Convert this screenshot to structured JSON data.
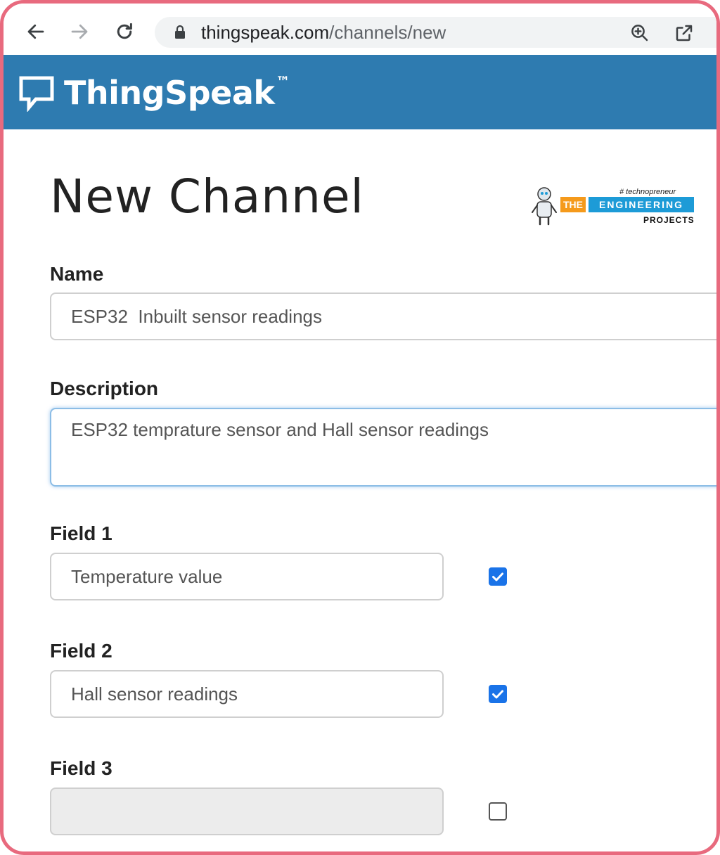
{
  "browser": {
    "url_host": "thingspeak.com",
    "url_path": "/channels/new",
    "icons": [
      "back-icon",
      "forward-icon",
      "reload-icon",
      "lock-icon",
      "zoom-icon",
      "share-icon"
    ]
  },
  "header": {
    "brand": "ThingSpeak",
    "trademark": "™",
    "background": "#2e7bb0"
  },
  "watermark": {
    "tagline": "# technopreneur",
    "the": "THE",
    "engineering": "ENGINEERING",
    "projects": "PROJECTS"
  },
  "form": {
    "title": "New Channel",
    "name": {
      "label": "Name",
      "value": "ESP32  Inbuilt sensor readings"
    },
    "description": {
      "label": "Description",
      "value": "ESP32 temprature sensor and Hall sensor readings"
    },
    "fields": [
      {
        "label": "Field 1",
        "value": "Temperature value",
        "checked": true
      },
      {
        "label": "Field 2",
        "value": "Hall sensor readings",
        "checked": true
      },
      {
        "label": "Field 3",
        "value": "",
        "checked": false
      }
    ]
  },
  "colors": {
    "frame_border": "#e86a7e",
    "checkbox_checked": "#1a73e8",
    "focus_border": "#8cbde6"
  }
}
